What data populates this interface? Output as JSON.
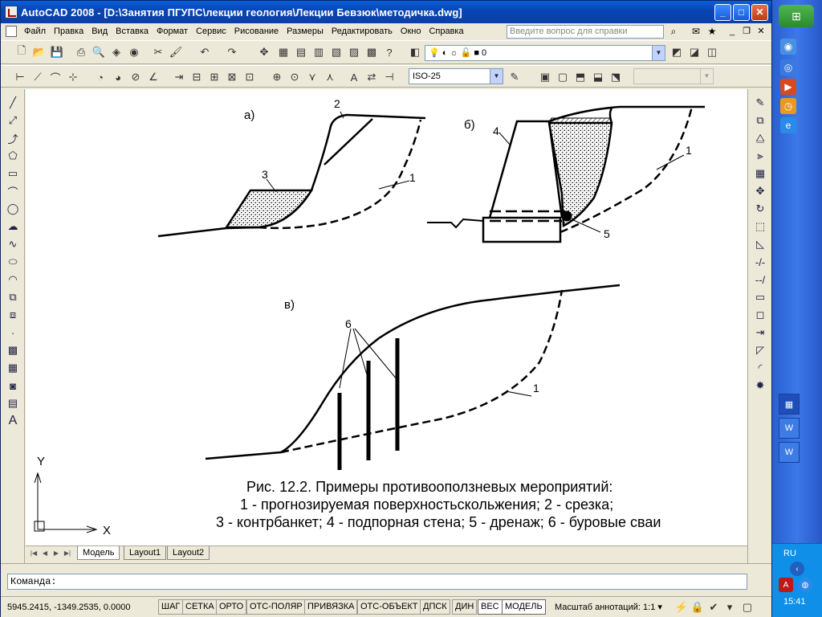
{
  "window": {
    "title": "AutoCAD 2008 - [D:\\Занятия ПГУПС\\лекции геология\\Лекции Бевзюк\\методичка.dwg]"
  },
  "menu": {
    "items": [
      "Файл",
      "Правка",
      "Вид",
      "Вставка",
      "Формат",
      "Сервис",
      "Рисование",
      "Размеры",
      "Редактировать",
      "Окно",
      "Справка"
    ],
    "help_placeholder": "Введите вопрос для справки"
  },
  "toolbar": {
    "layer_value": "0",
    "dimstyle_value": "ISO-25"
  },
  "drawing": {
    "label_a": "а)",
    "label_b": "б)",
    "label_v": "в)",
    "num_1a": "1",
    "num_2": "2",
    "num_3": "3",
    "num_1b": "1",
    "num_4": "4",
    "num_5": "5",
    "num_6": "6",
    "num_1c": "1",
    "ucs_y": "Y",
    "ucs_x": "X",
    "caption_line1": "Рис. 12.2. Примеры противооползневых мероприятий:",
    "caption_line2": "1 - прогнозируемая  поверхностьскольжения; 2 - срезка;",
    "caption_line3": "3 - контрбанкет; 4 - подпорная стена; 5 - дренаж; 6 - буровые сваи"
  },
  "tabs": [
    "Модель",
    "Layout1",
    "Layout2"
  ],
  "command": {
    "prompt": "Команда:"
  },
  "status": {
    "coordinates": "5945.2415, -1349.2535, 0.0000",
    "buttons": [
      "ШАГ",
      "СЕТКА",
      "ОРТО",
      "ОТС-ПОЛЯР",
      "ПРИВЯЗКА",
      "ОТС-ОБЪЕКТ",
      "ДПСК",
      "ДИН",
      "ВЕС",
      "МОДЕЛЬ"
    ],
    "annotation_scale_label": "Масштаб аннотаций:",
    "annotation_scale_value": "1:1"
  },
  "taskbar": {
    "language": "RU",
    "clock": "15:41"
  }
}
